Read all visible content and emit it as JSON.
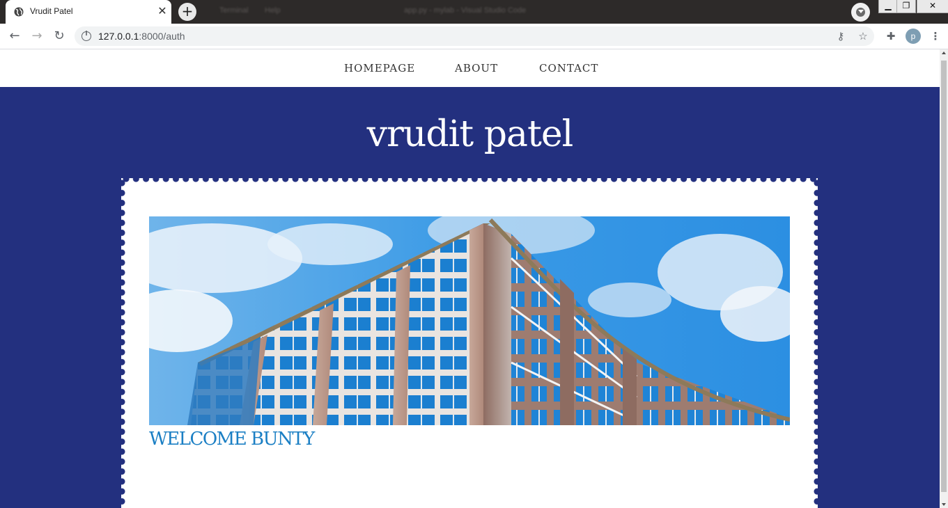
{
  "browser": {
    "tab_title": "Vrudit Patel",
    "url_host": "127.0.0.1",
    "url_path": ":8000/auth",
    "profile_initial": "p",
    "ghost_menu": [
      "Terminal",
      "Help"
    ],
    "ghost_title": "app.py - mylab - Visual Studio Code"
  },
  "nav": {
    "items": [
      "HOMEPAGE",
      "ABOUT",
      "CONTACT"
    ]
  },
  "site": {
    "title": "vrudit patel",
    "welcome": "WELCOME BUNTY"
  },
  "colors": {
    "primary_blue": "#23307f",
    "welcome_blue": "#1b7fc4",
    "sky": "#2b8fe0"
  },
  "icons": [
    "globe-icon",
    "close-icon",
    "plus-icon",
    "back-icon",
    "forward-icon",
    "reload-icon",
    "info-icon",
    "key-icon",
    "star-icon",
    "extension-icon",
    "menu-icon"
  ]
}
